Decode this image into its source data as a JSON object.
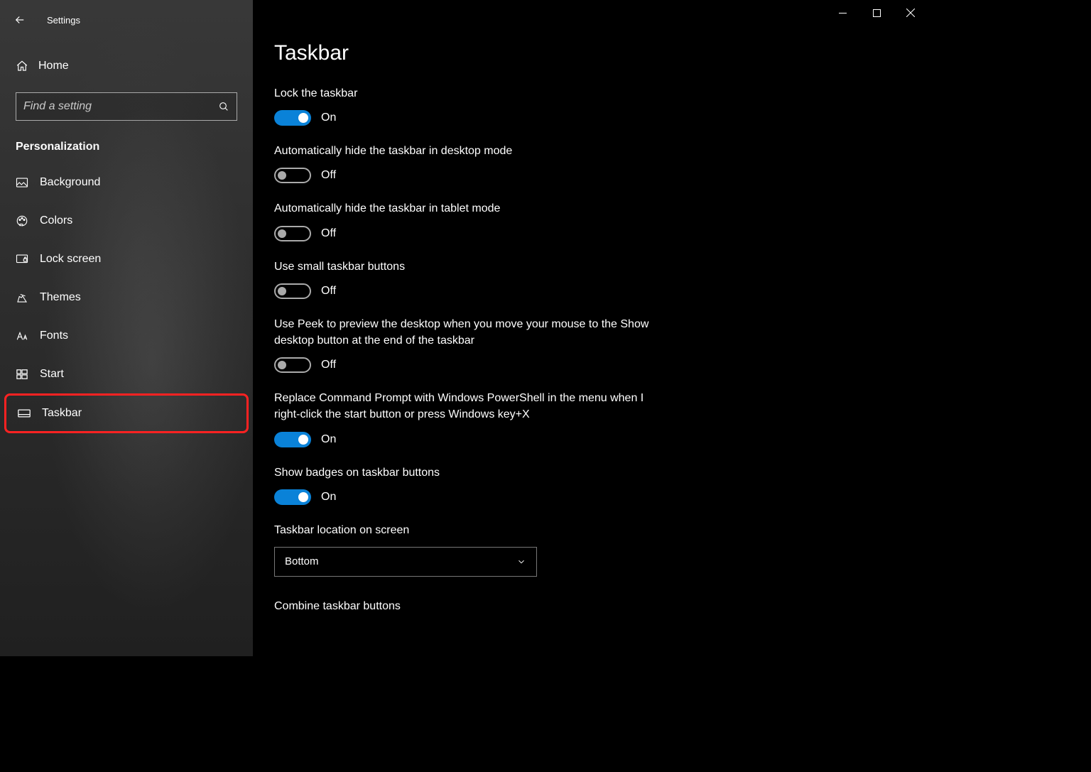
{
  "app_title": "Settings",
  "home_label": "Home",
  "search_placeholder": "Find a setting",
  "section": "Personalization",
  "nav": [
    {
      "icon": "picture",
      "label": "Background"
    },
    {
      "icon": "palette",
      "label": "Colors"
    },
    {
      "icon": "lock-screen",
      "label": "Lock screen"
    },
    {
      "icon": "themes",
      "label": "Themes"
    },
    {
      "icon": "fonts",
      "label": "Fonts"
    },
    {
      "icon": "start",
      "label": "Start"
    },
    {
      "icon": "taskbar",
      "label": "Taskbar"
    }
  ],
  "highlighted_nav_index": 6,
  "page_title": "Taskbar",
  "toggles": [
    {
      "label": "Lock the taskbar",
      "on": true,
      "state": "On"
    },
    {
      "label": "Automatically hide the taskbar in desktop mode",
      "on": false,
      "state": "Off"
    },
    {
      "label": "Automatically hide the taskbar in tablet mode",
      "on": false,
      "state": "Off"
    },
    {
      "label": "Use small taskbar buttons",
      "on": false,
      "state": "Off"
    },
    {
      "label": "Use Peek to preview the desktop when you move your mouse to the Show desktop button at the end of the taskbar",
      "on": false,
      "state": "Off"
    },
    {
      "label": "Replace Command Prompt with Windows PowerShell in the menu when I right-click the start button or press Windows key+X",
      "on": true,
      "state": "On"
    },
    {
      "label": "Show badges on taskbar buttons",
      "on": true,
      "state": "On"
    }
  ],
  "dropdown_label": "Taskbar location on screen",
  "dropdown_value": "Bottom",
  "trailing_label": "Combine taskbar buttons"
}
